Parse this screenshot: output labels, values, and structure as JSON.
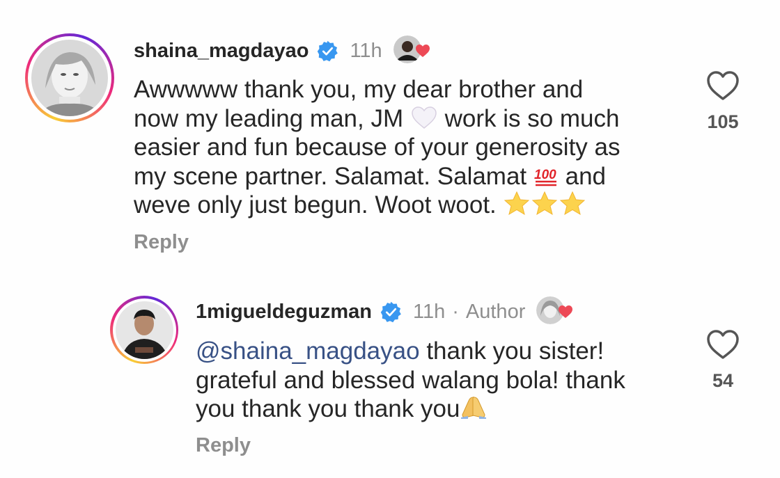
{
  "comments": [
    {
      "username": "shaina_magdayao",
      "time": "11h",
      "body_lines": [
        "Awwwww thank you, my dear brother and",
        "now my leading man, JM",
        "work is so much",
        "easier and fun because of your generosity as",
        "my scene partner. Salamat. Salamat",
        "and",
        "weve only just begun. Woot woot."
      ],
      "reply_label": "Reply",
      "like_count": "105"
    },
    {
      "username": "1migueldeguzman",
      "time": "11h",
      "author_badge": "Author",
      "mention": "@shaina_magdayao",
      "body_lines": [
        "thank you sister!",
        "grateful and blessed walang bola! thank",
        "you  thank you thank you"
      ],
      "reply_label": "Reply",
      "like_count": "54"
    }
  ],
  "colors": {
    "text": "#262626",
    "muted": "#8e8e8e",
    "verified": "#3897f0",
    "mention": "#385185",
    "heart_red": "#ed4956"
  },
  "icons": [
    "verified-badge-icon",
    "heart-outline-icon",
    "liked-by-author-heart-icon",
    "white-heart-emoji",
    "hundred-points-emoji",
    "star-emoji",
    "folded-hands-emoji"
  ]
}
